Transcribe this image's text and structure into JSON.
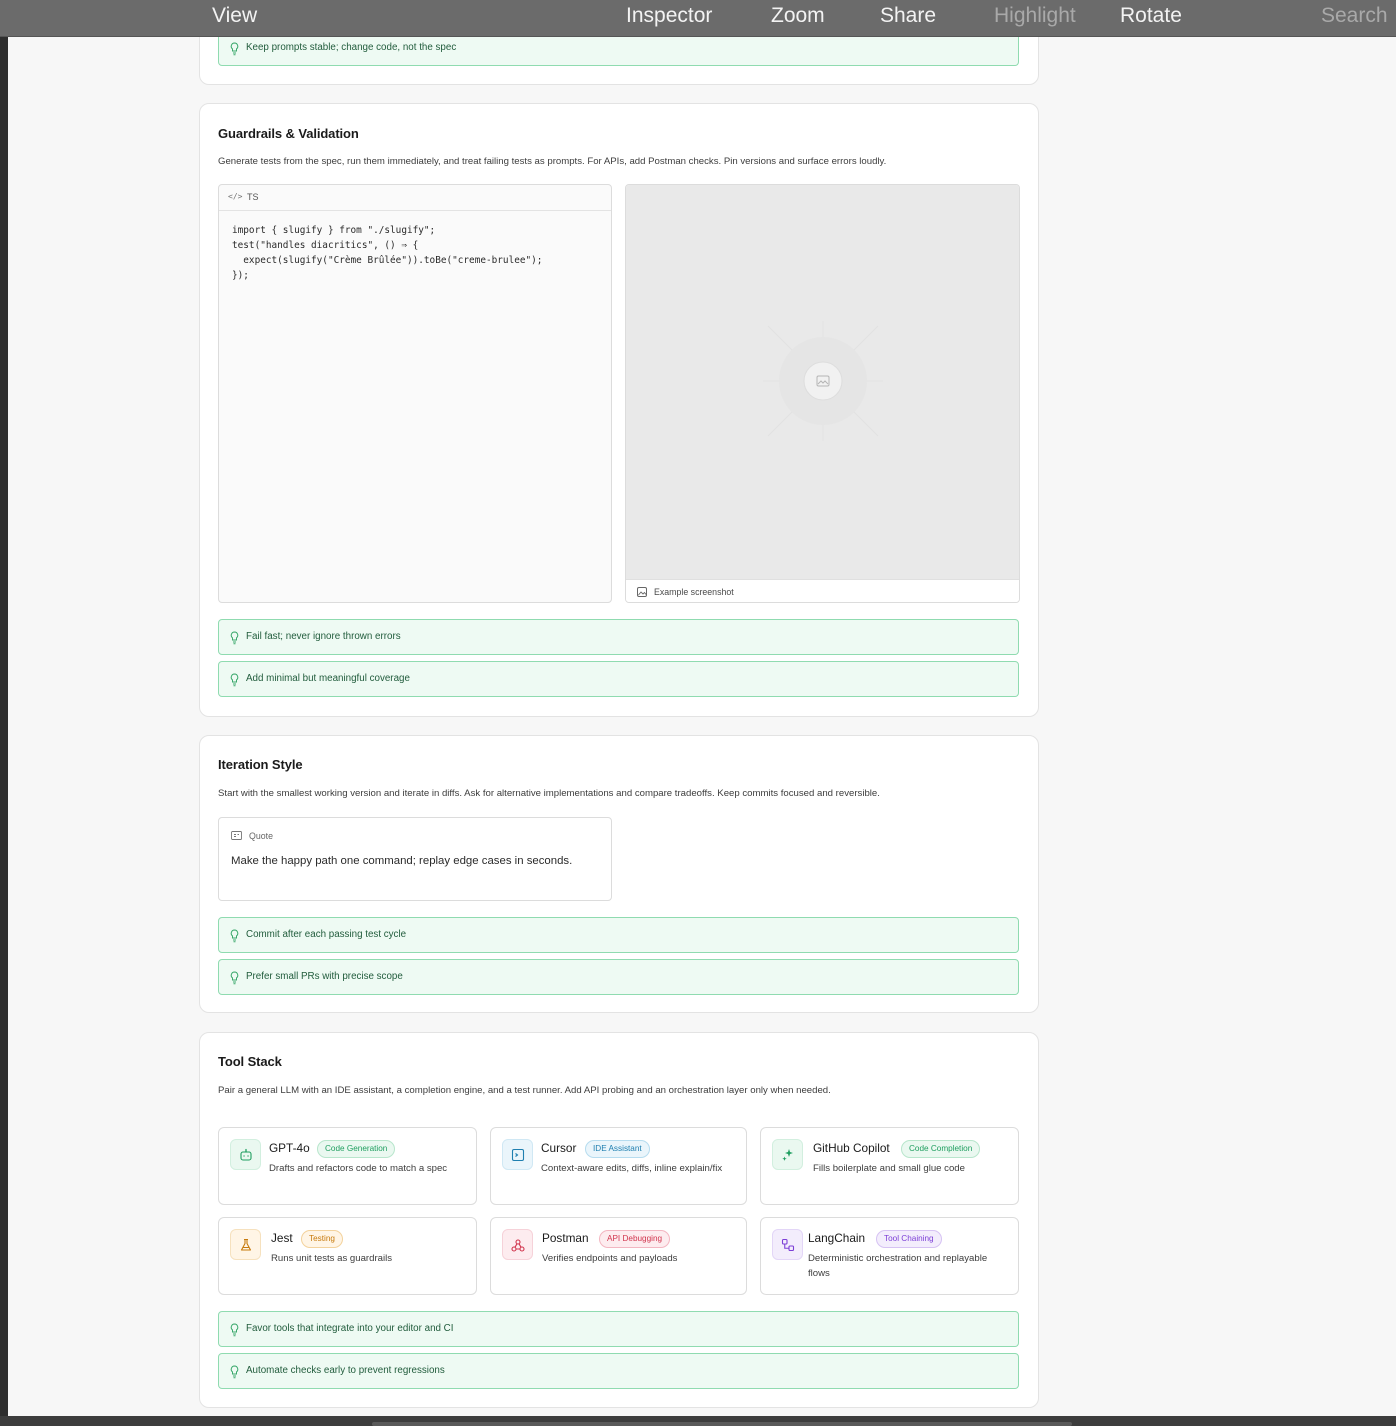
{
  "menu": {
    "items": [
      {
        "label": "View",
        "dim": false
      },
      {
        "label": "Inspector",
        "dim": false
      },
      {
        "label": "Zoom",
        "dim": false
      },
      {
        "label": "Share",
        "dim": false
      },
      {
        "label": "Highlight",
        "dim": true
      },
      {
        "label": "Rotate",
        "dim": false
      },
      {
        "label": "Search",
        "dim": true
      }
    ]
  },
  "top_card": {
    "tip": "Keep prompts stable; change code, not the spec"
  },
  "guardrails": {
    "title": "Guardrails & Validation",
    "description": "Generate tests from the spec, run them immediately, and treat failing tests as prompts. For APIs, add Postman checks. Pin versions and surface errors loudly.",
    "code": {
      "icon": "</>",
      "language": "TS",
      "lines": [
        "import { slugify } from \"./slugify\";",
        "test(\"handles diacritics\", () ⇒ {",
        "  expect(slugify(\"Crème Brûlée\")).toBe(\"creme-brulee\");",
        "});"
      ]
    },
    "image": {
      "icon": "image-icon",
      "caption": "Example screenshot"
    },
    "tips": [
      "Fail fast; never ignore thrown errors",
      "Add minimal but meaningful coverage"
    ]
  },
  "iteration": {
    "title": "Iteration Style",
    "description": "Start with the smallest working version and iterate in diffs. Ask for alternative implementations and compare tradeoffs. Keep commits focused and reversible.",
    "quote": {
      "label": "Quote",
      "text": "Make the happy path one command; replay edge cases in seconds."
    },
    "tips": [
      "Commit after each passing test cycle",
      "Prefer small PRs with precise scope"
    ]
  },
  "tool_stack": {
    "title": "Tool Stack",
    "description": "Pair a general LLM with an IDE assistant, a completion engine, and a test runner. Add API probing and an orchestration layer only when needed.",
    "tools": [
      {
        "name": "GPT-4o",
        "badge": "Code Generation",
        "description": "Drafts and refactors code to match a spec",
        "icon": "robot-icon",
        "color": "#1f9e5f",
        "bg": "#eaf8f0",
        "border": "#b8e6cc"
      },
      {
        "name": "Cursor",
        "badge": "IDE Assistant",
        "description": "Context-aware edits, diffs, inline explain/fix",
        "icon": "terminal-icon",
        "color": "#1f7fb0",
        "bg": "#eaf5fb",
        "border": "#b6dcef"
      },
      {
        "name": "GitHub Copilot",
        "badge": "Code Completion",
        "description": "Fills boilerplate and small glue code",
        "icon": "sparkles-icon",
        "color": "#1f9e5f",
        "bg": "#eaf8f0",
        "border": "#b8e6cc"
      },
      {
        "name": "Jest",
        "badge": "Testing",
        "description": "Runs unit tests as guardrails",
        "icon": "flask-icon",
        "color": "#c77a0c",
        "bg": "#fff5e6",
        "border": "#f3d29c"
      },
      {
        "name": "Postman",
        "badge": "API Debugging",
        "description": "Verifies endpoints and payloads",
        "icon": "webhook-icon",
        "color": "#d1344d",
        "bg": "#fdecef",
        "border": "#f3b6c1"
      },
      {
        "name": "LangChain",
        "badge": "Tool Chaining",
        "description": "Deterministic orchestration and replayable flows",
        "icon": "workflow-icon",
        "color": "#7c3fd6",
        "bg": "#f3edfc",
        "border": "#d6c2f3"
      }
    ],
    "tips": [
      "Favor tools that integrate into your editor and CI",
      "Automate checks early to prevent regressions"
    ]
  }
}
